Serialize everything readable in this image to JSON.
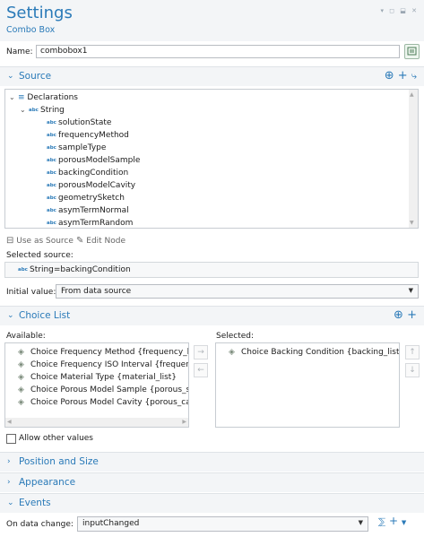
{
  "header": {
    "title": "Settings",
    "subtitle": "Combo Box",
    "window_controls": "▾ ◻ ⬓ ✕"
  },
  "name": {
    "label": "Name:",
    "value": "combobox1"
  },
  "source": {
    "section_label": "Source",
    "tree": {
      "root": "Declarations",
      "group": "String",
      "items": [
        "solutionState",
        "frequencyMethod",
        "sampleType",
        "porousModelSample",
        "backingCondition",
        "porousModelCavity",
        "geometrySketch",
        "asymTermNormal",
        "asymTermRandom"
      ]
    },
    "type_badge": "abc",
    "use_as_source": "Use as Source",
    "edit_node": "Edit Node",
    "selected_label": "Selected source:",
    "selected_value": "String=backingCondition",
    "initial_label": "Initial value:",
    "initial_value": "From data source"
  },
  "choice_list": {
    "section_label": "Choice List",
    "available_label": "Available:",
    "selected_label": "Selected:",
    "available": [
      "Choice Frequency Method {frequency_list",
      "Choice Frequency ISO Interval {frequency",
      "Choice Material Type {material_list}",
      "Choice Porous Model Sample {porous_sar",
      "Choice Porous Model Cavity {porous_cavi"
    ],
    "selected": [
      "Choice Backing Condition {backing_list}"
    ],
    "allow_other": "Allow other values"
  },
  "sections": {
    "position_size": "Position and Size",
    "appearance": "Appearance",
    "events": "Events"
  },
  "events": {
    "on_change_label": "On data change:",
    "on_change_value": "inputChanged"
  },
  "colors": {
    "accent": "#2a7ab8",
    "header_bg": "#f3f5f7"
  }
}
